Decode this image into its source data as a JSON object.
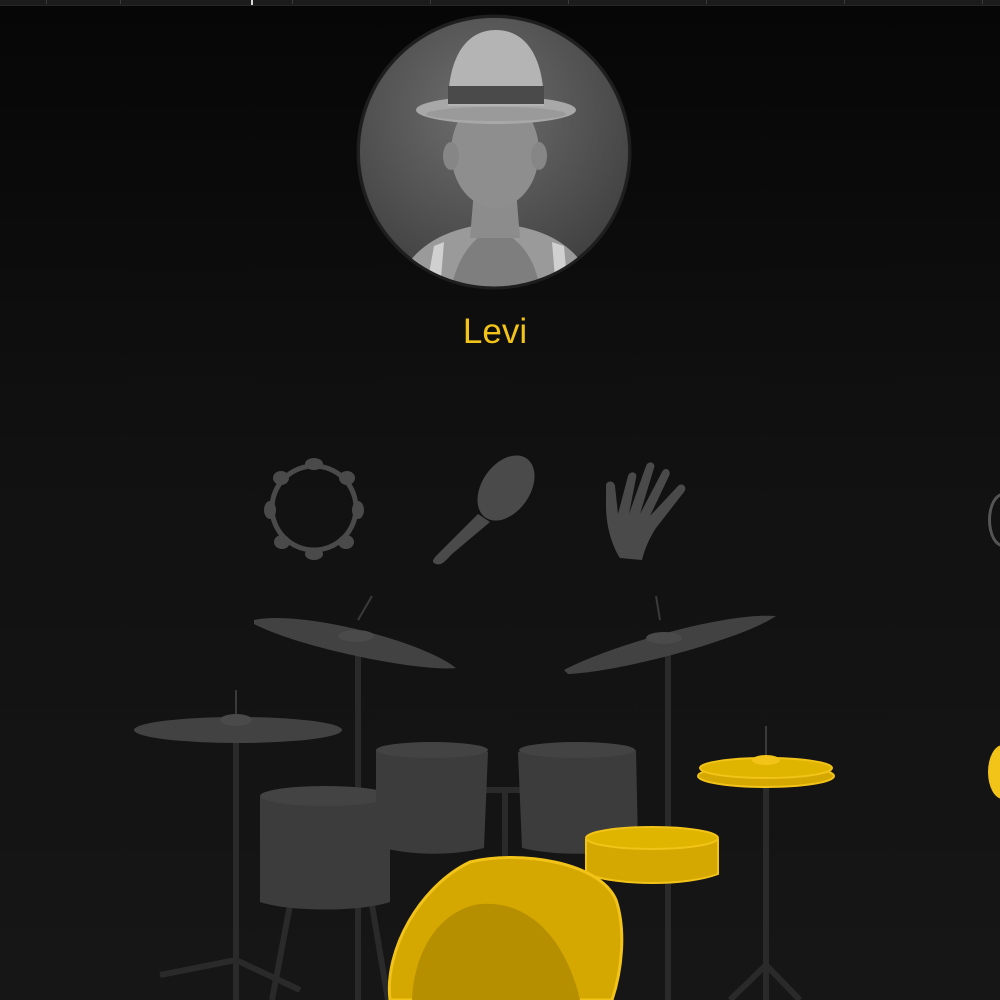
{
  "drummer": {
    "name": "Levi",
    "avatar_icon": "drummer-portrait-icon"
  },
  "percussion": [
    {
      "name": "tambourine",
      "icon": "tambourine-icon",
      "active": false
    },
    {
      "name": "shaker",
      "icon": "shaker-icon",
      "active": false
    },
    {
      "name": "hand-clap",
      "icon": "hand-clap-icon",
      "active": false
    }
  ],
  "kit": {
    "crash_left": {
      "active": false
    },
    "crash_right": {
      "active": false
    },
    "ride": {
      "active": false
    },
    "hi_hat": {
      "active": true
    },
    "tom_1": {
      "active": false
    },
    "tom_2": {
      "active": false
    },
    "floor_tom": {
      "active": false
    },
    "snare": {
      "active": true
    },
    "kick": {
      "active": true
    }
  },
  "side_controls": [
    {
      "name": "upper-toggle",
      "active": false
    },
    {
      "name": "lower-toggle",
      "active": true
    }
  ],
  "colors": {
    "accent": "#f2c318",
    "active_fill": "#d4a800",
    "active_stroke": "#f2c318",
    "inactive_fill": "#3c3c3c",
    "inactive_dark": "#2e2e2e",
    "hardware": "#2a2a2a",
    "background": "#0a0a0a"
  }
}
